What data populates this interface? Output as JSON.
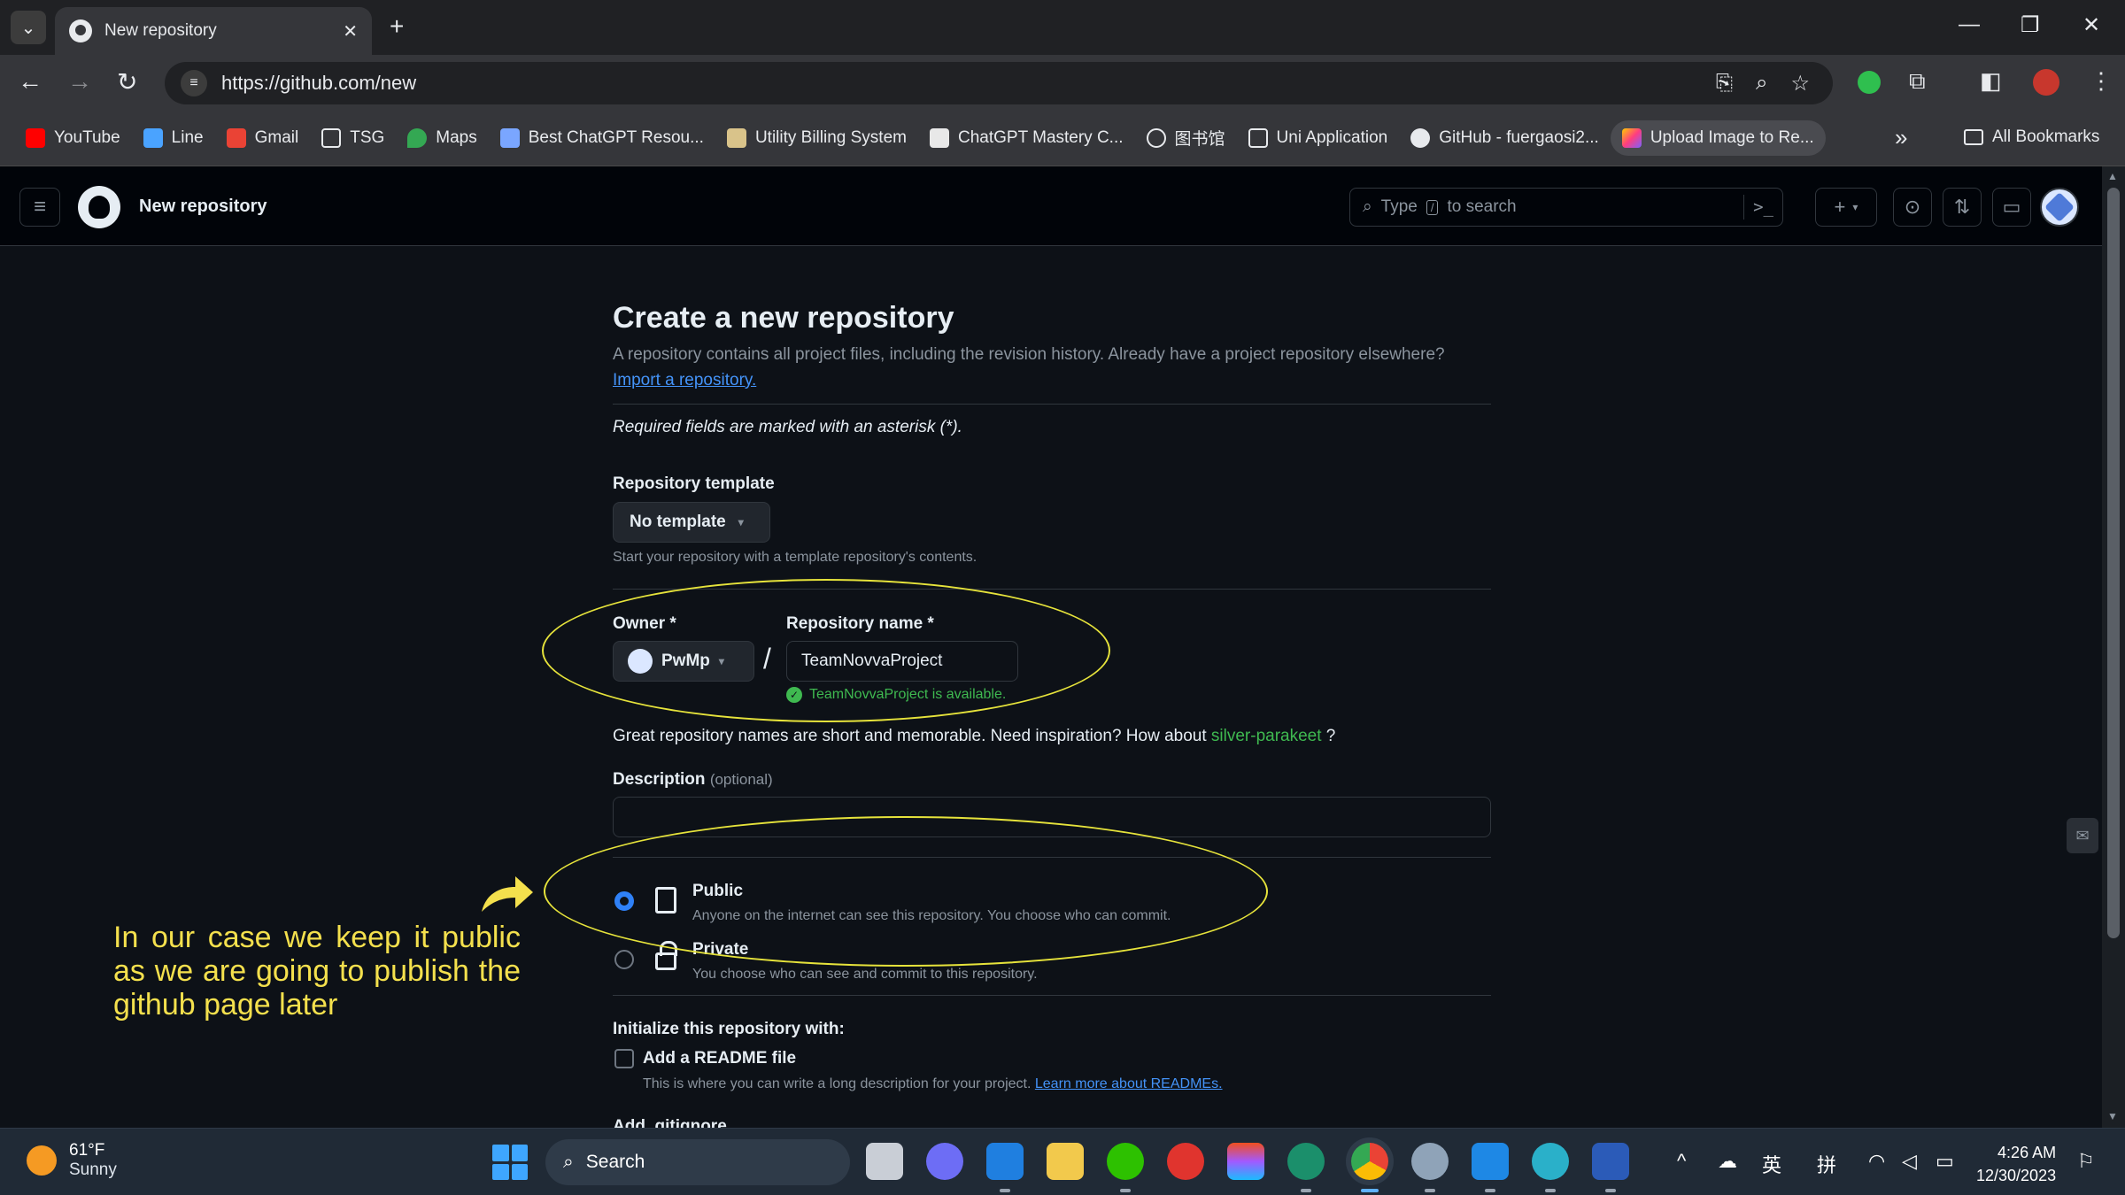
{
  "browser": {
    "tab_title": "New repository",
    "url": "https://github.com/new",
    "bookmarks": [
      {
        "label": "YouTube",
        "color": "#ff0000"
      },
      {
        "label": "Line",
        "color": "#4aa3ff"
      },
      {
        "label": "Gmail",
        "color": "#ea4335"
      },
      {
        "label": "TSG",
        "color": "folder"
      },
      {
        "label": "Maps",
        "color": "#34a853"
      },
      {
        "label": "Best ChatGPT Resou...",
        "color": "#7aa6ff"
      },
      {
        "label": "Utility Billing System",
        "color": "#d9c38a"
      },
      {
        "label": "ChatGPT Mastery C...",
        "color": "#e8e8e8"
      },
      {
        "label": "图书馆",
        "color": "#e8eaed"
      },
      {
        "label": "Uni Application",
        "color": "folder"
      },
      {
        "label": "GitHub - fuergaosi2...",
        "color": "#e8eaed"
      },
      {
        "label": "Upload Image to Re...",
        "color": "#ff7a59"
      }
    ],
    "all_bookmarks": "All Bookmarks"
  },
  "github": {
    "context_title": "New repository",
    "search_prefix": "Type",
    "search_key": "/",
    "search_suffix": "to search",
    "search_cmd": ">_"
  },
  "form": {
    "title": "Create a new repository",
    "subtitle": "A repository contains all project files, including the revision history. Already have a project repository elsewhere?",
    "import_link": "Import a repository.",
    "required_note": "Required fields are marked with an asterisk (*).",
    "template_label": "Repository template",
    "template_value": "No template",
    "template_hint": "Start your repository with a template repository's contents.",
    "owner_label": "Owner *",
    "owner_value": "PwMp",
    "name_label": "Repository name *",
    "name_value": "TeamNovvaProject",
    "availability": "TeamNovvaProject is available.",
    "inspiration_text": "Great repository names are short and memorable. Need inspiration? How about",
    "inspiration_suggestion": "silver-parakeet",
    "inspiration_end": "?",
    "description_label": "Description",
    "description_optional": "(optional)",
    "description_value": "",
    "visibility": {
      "selected": "public",
      "public_title": "Public",
      "public_desc": "Anyone on the internet can see this repository. You choose who can commit.",
      "private_title": "Private",
      "private_desc": "You choose who can see and commit to this repository."
    },
    "init_label": "Initialize this repository with:",
    "readme_label": "Add a README file",
    "readme_desc": "This is where you can write a long description for your project.",
    "readme_link": "Learn more about READMEs.",
    "next_section_partial": "Add .gitignore"
  },
  "annotation": {
    "note": "In our case we keep it public as we are going to publish the github page later",
    "color": "#f4e04d"
  },
  "taskbar": {
    "temperature": "61°F",
    "condition": "Sunny",
    "search_label": "Search",
    "ime_lang": "英",
    "ime_mode": "拼",
    "time": "4:26 AM",
    "date": "12/30/2023"
  }
}
